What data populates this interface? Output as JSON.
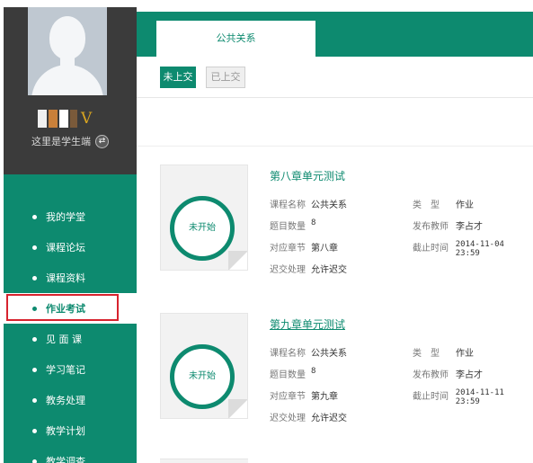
{
  "profile": {
    "username_suffix": "V",
    "role_text": "这里是学生端"
  },
  "menu": {
    "items": [
      {
        "label": "我的学堂"
      },
      {
        "label": "课程论坛"
      },
      {
        "label": "课程资料"
      },
      {
        "label": "作业考试"
      },
      {
        "label": "见 面 课"
      },
      {
        "label": "学习笔记"
      },
      {
        "label": "教务处理"
      },
      {
        "label": "教学计划"
      },
      {
        "label": "教学调查"
      }
    ],
    "active": "作业考试"
  },
  "header": {
    "course_tab": "公共关系"
  },
  "filters": {
    "pending": "未上交",
    "submitted": "已上交"
  },
  "colors": {
    "brand": "#0d8a6f",
    "highlight": "#d7232e"
  },
  "tasks": [
    {
      "status": "未开始",
      "title": "第八章单元测试",
      "course_label": "课程名称",
      "course": "公共关系",
      "type_label": "类　型",
      "type": "作业",
      "count_label": "题目数量",
      "count": "8",
      "teacher_label": "发布教师",
      "teacher": "李占才",
      "chapter_label": "对应章节",
      "chapter": "第八章",
      "deadline_label": "截止时间",
      "deadline": "2014-11-04 23:59",
      "late_label": "迟交处理",
      "late": "允许迟交"
    },
    {
      "status": "未开始",
      "title": "第九章单元测试",
      "course_label": "课程名称",
      "course": "公共关系",
      "type_label": "类　型",
      "type": "作业",
      "count_label": "题目数量",
      "count": "8",
      "teacher_label": "发布教师",
      "teacher": "李占才",
      "chapter_label": "对应章节",
      "chapter": "第九章",
      "deadline_label": "截止时间",
      "deadline": "2014-11-11 23:59",
      "late_label": "迟交处理",
      "late": "允许迟交"
    }
  ]
}
